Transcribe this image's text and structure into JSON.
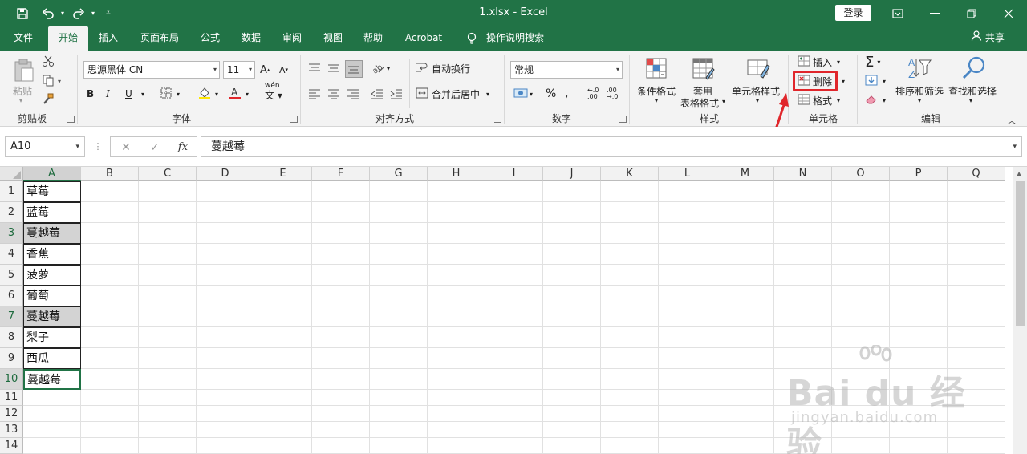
{
  "titlebar": {
    "title": "1.xlsx  -  Excel",
    "login_label": "登录",
    "accent_color": "#217346"
  },
  "menu": {
    "tabs": [
      "文件",
      "开始",
      "插入",
      "页面布局",
      "公式",
      "数据",
      "审阅",
      "视图",
      "帮助",
      "Acrobat"
    ],
    "active_tab": "开始",
    "tell_me": "操作说明搜索",
    "share": "共享"
  },
  "ribbon": {
    "clipboard": {
      "paste": "粘贴",
      "label": "剪贴板"
    },
    "font": {
      "name": "思源黑体 CN",
      "size": "11",
      "bold": "B",
      "italic": "I",
      "underline": "U",
      "label": "字体",
      "phonetic": "wén"
    },
    "alignment": {
      "wrap_text": "自动换行",
      "merge_center": "合并后居中",
      "label": "对齐方式"
    },
    "number": {
      "format": "常规",
      "percent": "%",
      "label": "数字"
    },
    "styles": {
      "conditional": "条件格式",
      "table_line1": "套用",
      "table_line2": "表格格式",
      "cell_styles": "单元格样式",
      "label": "样式"
    },
    "cells": {
      "insert": "插入",
      "delete": "删除",
      "format": "格式",
      "label": "单元格"
    },
    "editing": {
      "sort_filter": "排序和筛选",
      "find_select": "查找和选择",
      "label": "编辑"
    },
    "highlight_color": "#e0262b"
  },
  "formula_bar": {
    "name_box": "A10",
    "value": "蔓越莓"
  },
  "grid": {
    "columns": [
      "A",
      "B",
      "C",
      "D",
      "E",
      "F",
      "G",
      "H",
      "I",
      "J",
      "K",
      "L",
      "M",
      "N",
      "O",
      "P",
      "Q"
    ],
    "rows": [
      "1",
      "2",
      "3",
      "4",
      "5",
      "6",
      "7",
      "8",
      "9",
      "10",
      "11",
      "12",
      "13",
      "14"
    ],
    "column_a_values": [
      "草莓",
      "蓝莓",
      "蔓越莓",
      "香蕉",
      "菠萝",
      "葡萄",
      "蔓越莓",
      "梨子",
      "西瓜",
      "蔓越莓"
    ],
    "highlighted_rows": [
      "3",
      "7"
    ],
    "active_cell": "A10"
  },
  "watermark": {
    "brand": "Bai du 经验",
    "url": "jingyan.baidu.com"
  }
}
